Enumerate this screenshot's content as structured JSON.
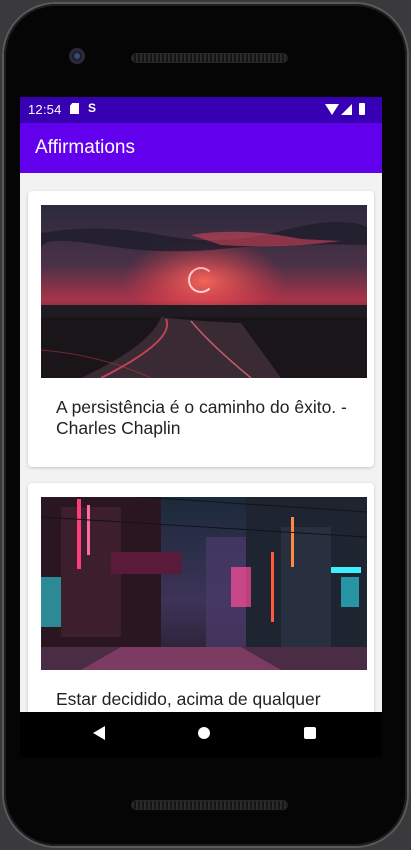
{
  "status_bar": {
    "time": "12:54",
    "icons": [
      "sd-card-icon",
      "sync-icon",
      "wifi-icon",
      "signal-icon",
      "battery-icon"
    ]
  },
  "app_bar": {
    "title": "Affirmations"
  },
  "affirmations": [
    {
      "text": "A persistência é o caminho do êxito. - Charles Chaplin",
      "image": "sunset-road-painting"
    },
    {
      "text": "Estar decidido, acima de qualquer outra coisa, é o segredo do êxito.",
      "image": "neon-city-street-painting"
    }
  ],
  "nav_bar": {
    "buttons": [
      "back-icon",
      "home-icon",
      "recents-icon"
    ]
  },
  "colors": {
    "status_bar": "#3700b3",
    "app_bar": "#6200ee",
    "background": "#f2f2f2",
    "card": "#ffffff"
  }
}
